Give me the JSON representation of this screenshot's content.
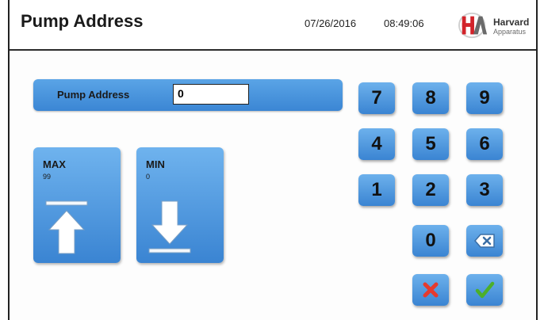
{
  "header": {
    "title": "Pump Address",
    "date": "07/26/2016",
    "time": "08:49:06",
    "logo": {
      "mark": "HA",
      "name": "Harvard",
      "sub": "Apparatus"
    }
  },
  "address": {
    "label": "Pump Address",
    "value": "0"
  },
  "limits": {
    "max": {
      "label": "MAX",
      "value": "99"
    },
    "min": {
      "label": "MIN",
      "value": "0"
    }
  },
  "keypad": {
    "keys": [
      "7",
      "8",
      "9",
      "4",
      "5",
      "6",
      "1",
      "2",
      "3",
      "0"
    ],
    "backspace_icon": "backspace-icon",
    "cancel_icon": "cancel-icon",
    "confirm_icon": "confirm-icon"
  },
  "colors": {
    "button_blue": "#3a84d2",
    "cancel_red": "#e53a2e",
    "confirm_green": "#4caf2a",
    "logo_red": "#d2232a"
  }
}
